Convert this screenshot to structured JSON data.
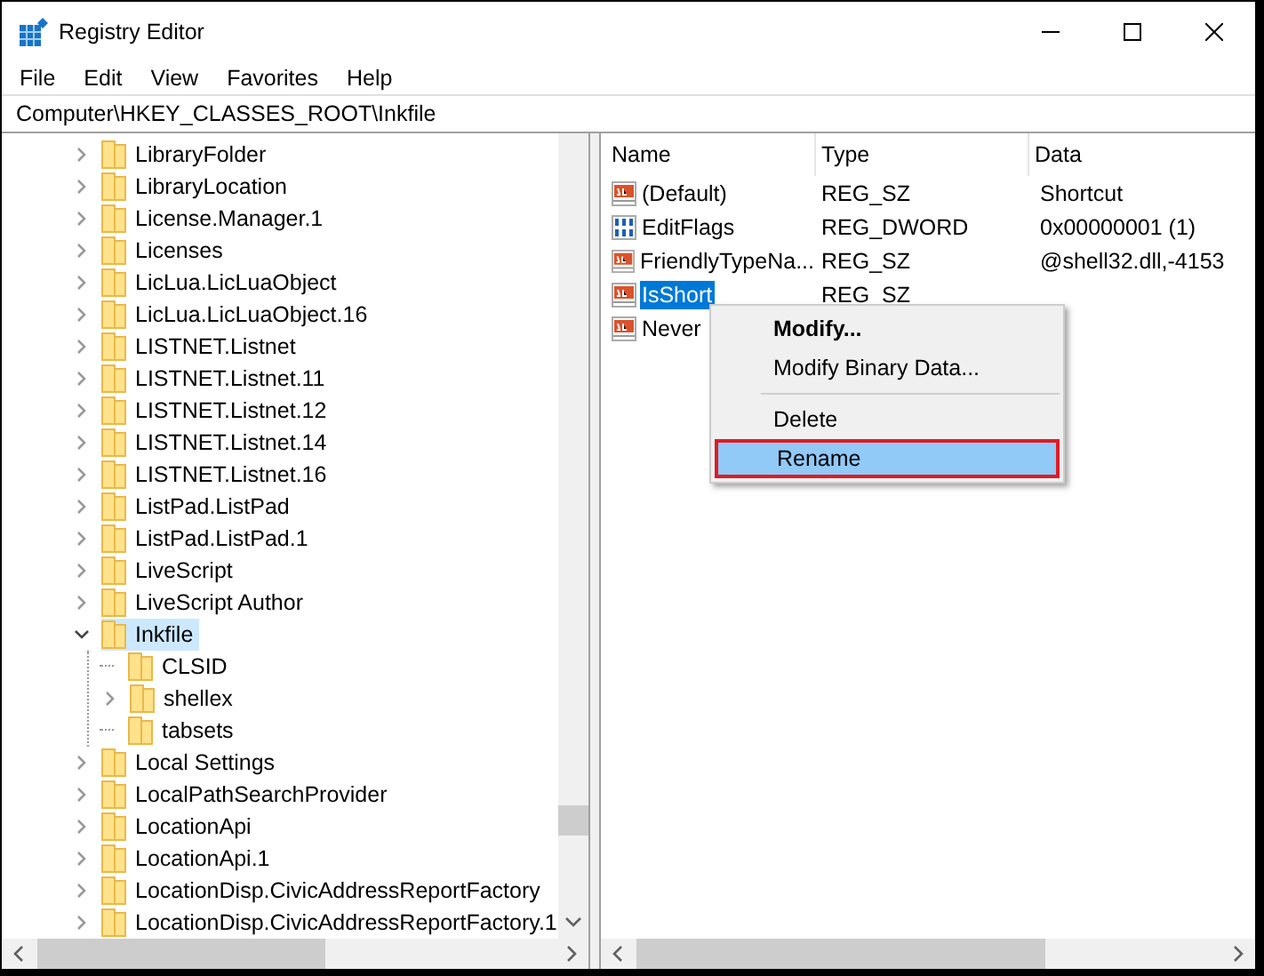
{
  "window": {
    "title": "Registry Editor"
  },
  "menu": [
    "File",
    "Edit",
    "View",
    "Favorites",
    "Help"
  ],
  "address": "Computer\\HKEY_CLASSES_ROOT\\Inkfile",
  "tree": [
    {
      "label": "LibraryFolder",
      "expanded": false,
      "selected": false
    },
    {
      "label": "LibraryLocation",
      "expanded": false,
      "selected": false
    },
    {
      "label": "License.Manager.1",
      "expanded": false,
      "selected": false
    },
    {
      "label": "Licenses",
      "expanded": false,
      "selected": false
    },
    {
      "label": "LicLua.LicLuaObject",
      "expanded": false,
      "selected": false
    },
    {
      "label": "LicLua.LicLuaObject.16",
      "expanded": false,
      "selected": false
    },
    {
      "label": "LISTNET.Listnet",
      "expanded": false,
      "selected": false
    },
    {
      "label": "LISTNET.Listnet.11",
      "expanded": false,
      "selected": false
    },
    {
      "label": "LISTNET.Listnet.12",
      "expanded": false,
      "selected": false
    },
    {
      "label": "LISTNET.Listnet.14",
      "expanded": false,
      "selected": false
    },
    {
      "label": "LISTNET.Listnet.16",
      "expanded": false,
      "selected": false
    },
    {
      "label": "ListPad.ListPad",
      "expanded": false,
      "selected": false
    },
    {
      "label": "ListPad.ListPad.1",
      "expanded": false,
      "selected": false
    },
    {
      "label": "LiveScript",
      "expanded": false,
      "selected": false
    },
    {
      "label": "LiveScript Author",
      "expanded": false,
      "selected": false
    },
    {
      "label": "Inkfile",
      "expanded": true,
      "selected": true,
      "children": [
        {
          "label": "CLSID",
          "selected": false
        },
        {
          "label": "shellex",
          "expanded": false,
          "selected": false
        },
        {
          "label": "tabsets",
          "selected": false
        }
      ]
    },
    {
      "label": "Local Settings",
      "expanded": false,
      "selected": false
    },
    {
      "label": "LocalPathSearchProvider",
      "expanded": false,
      "selected": false
    },
    {
      "label": "LocationApi",
      "expanded": false,
      "selected": false
    },
    {
      "label": "LocationApi.1",
      "expanded": false,
      "selected": false
    },
    {
      "label": "LocationDisp.CivicAddressReportFactory",
      "expanded": false,
      "selected": false
    },
    {
      "label": "LocationDisp.CivicAddressReportFactory.1",
      "expanded": false,
      "selected": false
    }
  ],
  "table": {
    "columns": [
      "Name",
      "Type",
      "Data"
    ],
    "rows": [
      {
        "kind": "string",
        "name": "(Default)",
        "type": "REG_SZ",
        "data": "Shortcut",
        "selected": false
      },
      {
        "kind": "binary",
        "name": "EditFlags",
        "type": "REG_DWORD",
        "data": "0x00000001 (1)",
        "selected": false
      },
      {
        "kind": "string",
        "name": "FriendlyTypeNa...",
        "type": "REG_SZ",
        "data": "@shell32.dll,-4153",
        "selected": false
      },
      {
        "kind": "string",
        "name": "IsShort",
        "type": "REG_SZ",
        "selected": true
      },
      {
        "kind": "string",
        "name": "Never",
        "selected": false
      }
    ]
  },
  "context_menu": [
    {
      "kind": "item",
      "label": "Modify...",
      "bold": true,
      "highlighted": false
    },
    {
      "kind": "item",
      "label": "Modify Binary Data...",
      "bold": false,
      "highlighted": false
    },
    {
      "kind": "separator"
    },
    {
      "kind": "item",
      "label": "Delete",
      "bold": false,
      "highlighted": false
    },
    {
      "kind": "item",
      "label": "Rename",
      "bold": false,
      "highlighted": true
    }
  ]
}
